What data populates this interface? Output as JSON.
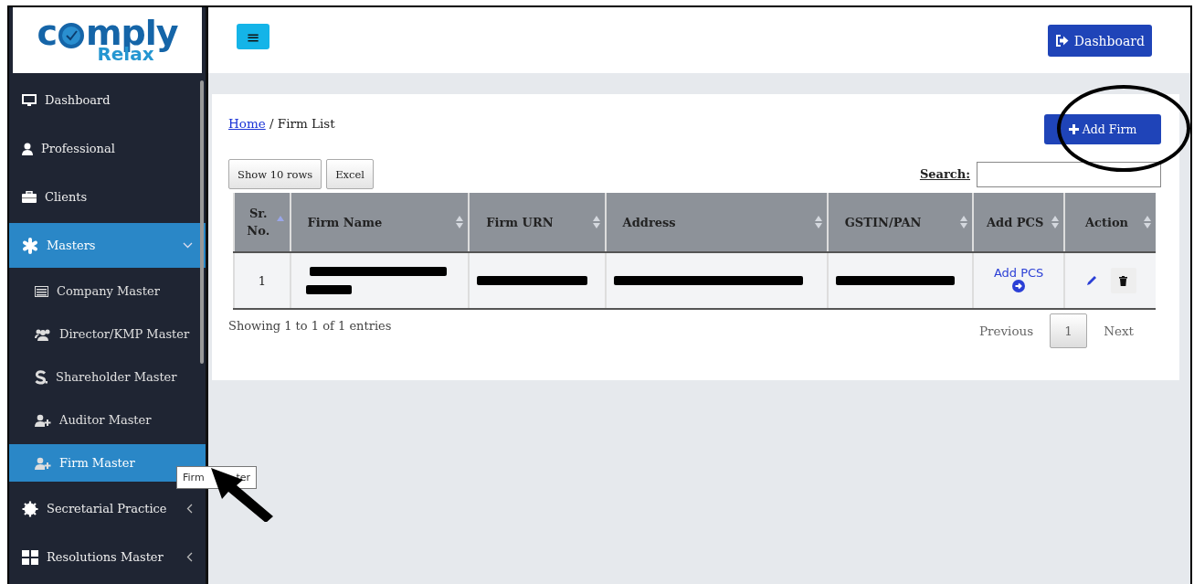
{
  "logo": {
    "word_start": "c",
    "word_end": "mply",
    "tagline": "Relax"
  },
  "sidebar": {
    "items": [
      {
        "label": "Dashboard",
        "kind": "link",
        "selected": false
      },
      {
        "label": "Professional",
        "kind": "link",
        "selected": false
      },
      {
        "label": "Clients",
        "kind": "link",
        "selected": false
      },
      {
        "label": "Masters",
        "kind": "menu",
        "selected": true,
        "expanded": true
      },
      {
        "label": "Company Master",
        "kind": "sub",
        "selected": false
      },
      {
        "label": "Director/KMP Master",
        "kind": "sub",
        "selected": false
      },
      {
        "label": "Shareholder Master",
        "kind": "sub",
        "selected": false
      },
      {
        "label": "Auditor Master",
        "kind": "sub",
        "selected": false
      },
      {
        "label": "Firm Master",
        "kind": "sub",
        "selected": true
      },
      {
        "label": "Secretarial Practice",
        "kind": "menu",
        "selected": false,
        "expanded": false
      },
      {
        "label": "Resolutions Master",
        "kind": "menu",
        "selected": false,
        "expanded": false
      }
    ]
  },
  "tooltip": {
    "text": "Firm",
    "tail": "ter"
  },
  "header": {
    "menu_button": "≡",
    "dashboard_button": "Dashboard"
  },
  "breadcrumb": {
    "link": "Home",
    "current": "/ Firm List"
  },
  "add_button": "Add Firm",
  "table_buttons": [
    "Show 10 rows",
    "Excel"
  ],
  "search": {
    "label": "Search:"
  },
  "table": {
    "columns": [
      {
        "label": "Sr. No.",
        "sorted": true
      },
      {
        "label": "Firm Name",
        "sorted": false
      },
      {
        "label": "Firm URN",
        "sorted": false
      },
      {
        "label": "Address",
        "sorted": false
      },
      {
        "label": "GSTIN/PAN",
        "sorted": false
      },
      {
        "label": "Add PCS",
        "sorted": false
      },
      {
        "label": "Action",
        "sorted": false
      }
    ],
    "rows": [
      [
        {
          "kind": "text",
          "text": "1"
        },
        {
          "kind": "redacted-wrapped"
        },
        {
          "kind": "redacted"
        },
        {
          "kind": "redacted"
        },
        {
          "kind": "redacted"
        },
        {
          "kind": "link",
          "text": "Add PCS"
        },
        {
          "kind": "actions"
        }
      ]
    ]
  },
  "info": "Showing 1 to 1 of 1 entries",
  "pagination": {
    "previous": "Previous",
    "pages": [
      {
        "label": "1",
        "selected": true
      }
    ],
    "next": "Next"
  }
}
